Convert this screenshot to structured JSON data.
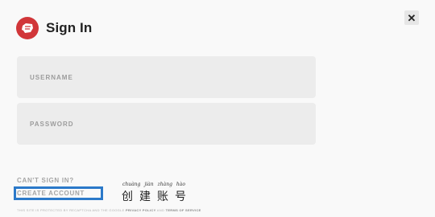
{
  "header": {
    "title": "Sign In",
    "logo_icon": "riot-fist-icon",
    "logo_color": "#d13639"
  },
  "close_button": {
    "label": "✕"
  },
  "form": {
    "username_placeholder": "USERNAME",
    "password_placeholder": "PASSWORD"
  },
  "links": {
    "cant_sign_in": "CAN'T SIGN IN?",
    "create_account": "CREATE ACCOUNT"
  },
  "annotation": {
    "pinyin": [
      "chuàng",
      "jiàn",
      "zhàng",
      "hào"
    ],
    "hanzi": [
      "创",
      "建",
      "账",
      "号"
    ],
    "highlight_color": "#2b79c9"
  },
  "legal": {
    "prefix": "THIS SITE IS PROTECTED BY RECAPTCHA AND THE GOOGLE",
    "privacy": "PRIVACY POLICY",
    "and": "AND",
    "terms": "TERMS OF SERVICE"
  }
}
